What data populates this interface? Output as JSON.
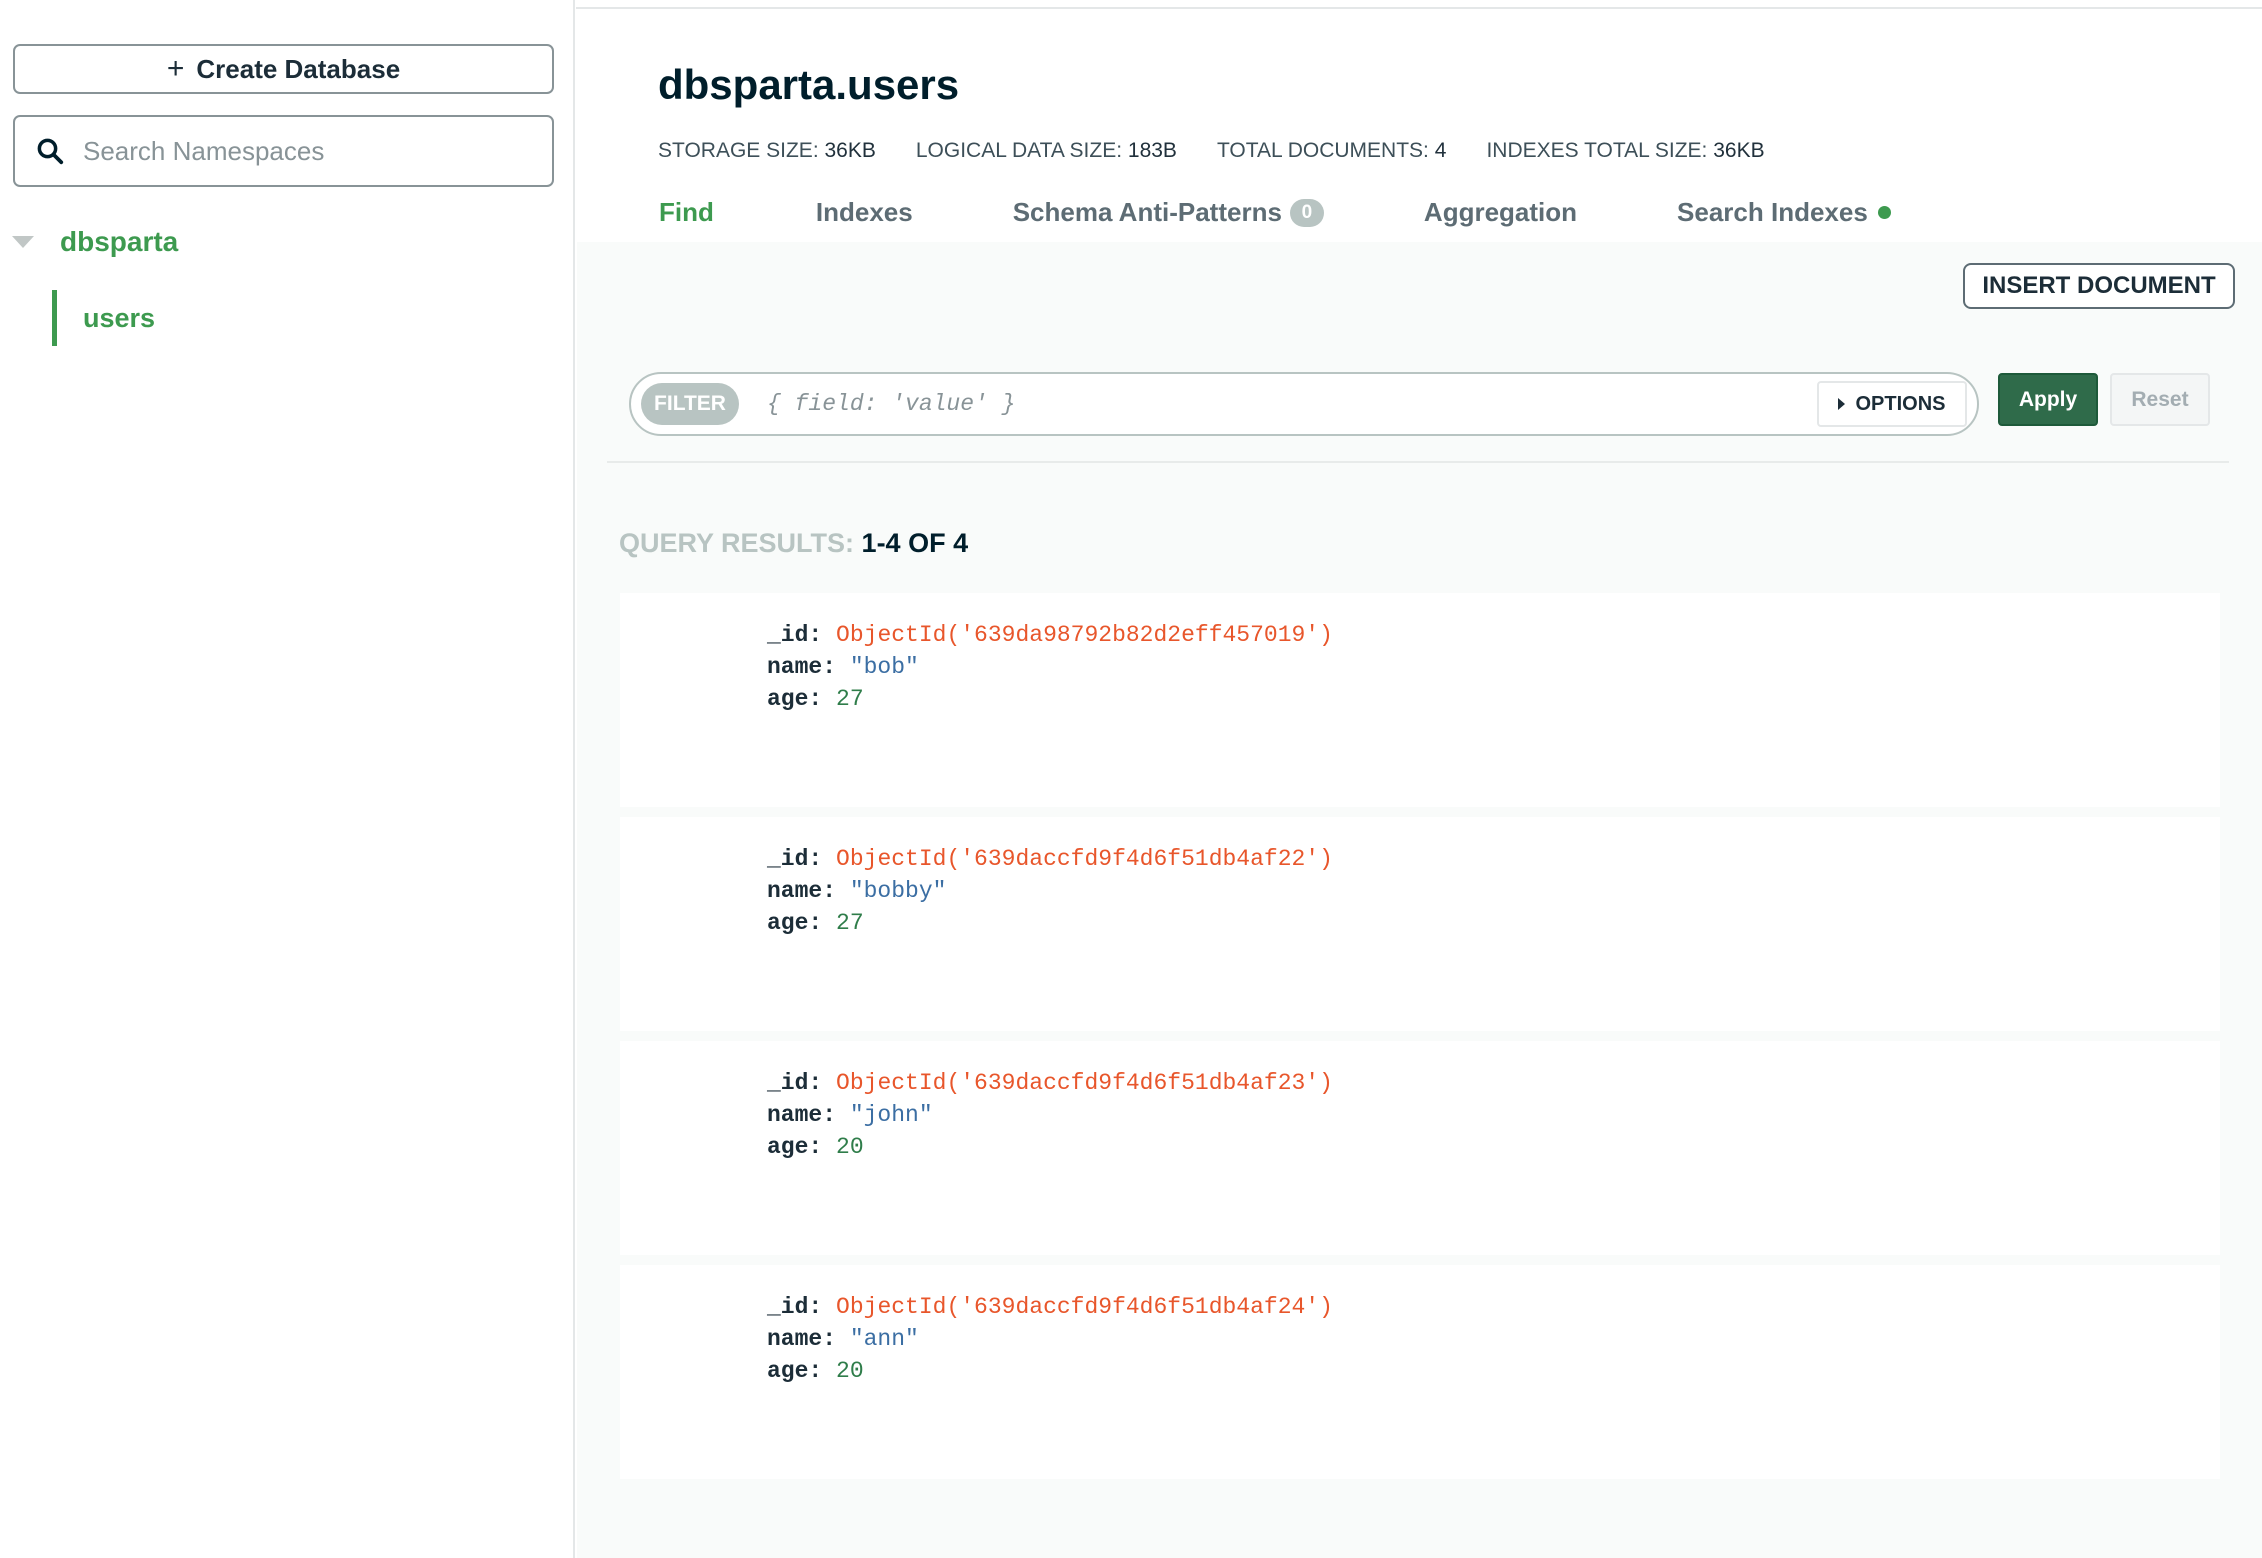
{
  "sidebar": {
    "create_button": "Create Database",
    "search_placeholder": "Search Namespaces",
    "database": "dbsparta",
    "collection": "users"
  },
  "header": {
    "title": "dbsparta.users",
    "stats": [
      {
        "label": "STORAGE SIZE:",
        "value": "36KB"
      },
      {
        "label": "LOGICAL DATA SIZE:",
        "value": "183B"
      },
      {
        "label": "TOTAL DOCUMENTS:",
        "value": "4"
      },
      {
        "label": "INDEXES TOTAL SIZE:",
        "value": "36KB"
      }
    ],
    "tabs": [
      {
        "label": "Find",
        "active": true
      },
      {
        "label": "Indexes"
      },
      {
        "label": "Schema Anti-Patterns",
        "badge": "0"
      },
      {
        "label": "Aggregation"
      },
      {
        "label": "Search Indexes",
        "status_dot": true
      }
    ]
  },
  "toolbar": {
    "insert_document": "INSERT DOCUMENT",
    "filter_label": "FILTER",
    "filter_placeholder": "{ field: 'value' }",
    "options_label": "OPTIONS",
    "apply_label": "Apply",
    "reset_label": "Reset"
  },
  "results": {
    "label": "QUERY RESULTS:",
    "count": "1-4 OF 4",
    "documents": [
      {
        "id_key": "_id:",
        "id_value": "ObjectId('639da98792b82d2eff457019')",
        "name_key": "name:",
        "name_value": "\"bob\"",
        "age_key": "age:",
        "age_value": "27"
      },
      {
        "id_key": "_id:",
        "id_value": "ObjectId('639daccfd9f4d6f51db4af22')",
        "name_key": "name:",
        "name_value": "\"bobby\"",
        "age_key": "age:",
        "age_value": "27"
      },
      {
        "id_key": "_id:",
        "id_value": "ObjectId('639daccfd9f4d6f51db4af23')",
        "name_key": "name:",
        "name_value": "\"john\"",
        "age_key": "age:",
        "age_value": "20"
      },
      {
        "id_key": "_id:",
        "id_value": "ObjectId('639daccfd9f4d6f51db4af24')",
        "name_key": "name:",
        "name_value": "\"ann\"",
        "age_key": "age:",
        "age_value": "20"
      }
    ]
  },
  "colors": {
    "accent_green": "#3d9a4f",
    "apply_green": "#2f6b4a",
    "objectid_orange": "#e8562b",
    "string_blue": "#3b6ea3",
    "number_green": "#2f7d4a"
  },
  "icons": {
    "create": "plus-icon",
    "search": "search-icon",
    "expand": "chevron-down-icon",
    "options": "caret-right-icon",
    "status": "status-dot-icon"
  }
}
